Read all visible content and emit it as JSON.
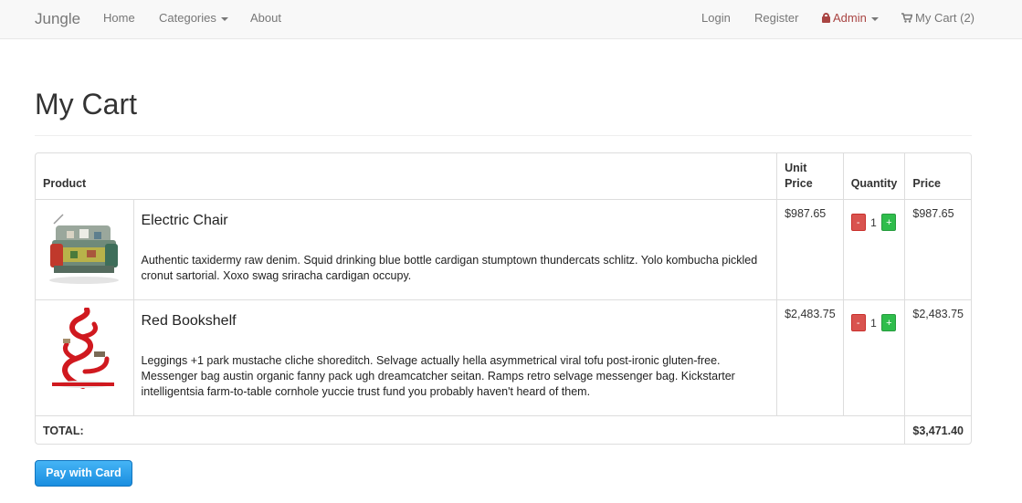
{
  "navbar": {
    "brand": "Jungle",
    "home": "Home",
    "categories": "Categories",
    "about": "About",
    "login": "Login",
    "register": "Register",
    "admin": "Admin",
    "cart": "My Cart (2)",
    "icons": {
      "admin": "lock-icon",
      "cart": "shopping-cart-icon"
    },
    "colors": {
      "admin": "#a94442"
    }
  },
  "page": {
    "title": "My Cart"
  },
  "table": {
    "headers": {
      "product": "Product",
      "unit_price": "Unit Price",
      "quantity": "Quantity",
      "price": "Price"
    },
    "items": [
      {
        "name": "Electric Chair",
        "description": "Authentic taxidermy raw denim. Squid drinking blue bottle cardigan stumptown thundercats schlitz. Yolo kombucha pickled cronut sartorial. Xoxo swag sriracha cardigan occupy.",
        "unit_price": "$987.65",
        "quantity": "1",
        "price": "$987.65",
        "minus": "-",
        "plus": "+"
      },
      {
        "name": "Red Bookshelf",
        "description": "Leggings +1 park mustache cliche shoreditch. Selvage actually hella asymmetrical viral tofu post-ironic gluten-free. Messenger bag austin organic fanny pack ugh dreamcatcher seitan. Ramps retro selvage messenger bag. Kickstarter intelligentsia farm-to-table cornhole yuccie trust fund you probably haven't heard of them.",
        "unit_price": "$2,483.75",
        "quantity": "1",
        "price": "$2,483.75",
        "minus": "-",
        "plus": "+"
      }
    ],
    "total_label": "TOTAL:",
    "total_value": "$3,471.40"
  },
  "pay_button": "Pay with Card",
  "colors": {
    "minus_button": "#d9534f",
    "plus_button": "#2fbd4c",
    "pay_button": "#1a8ee0"
  }
}
